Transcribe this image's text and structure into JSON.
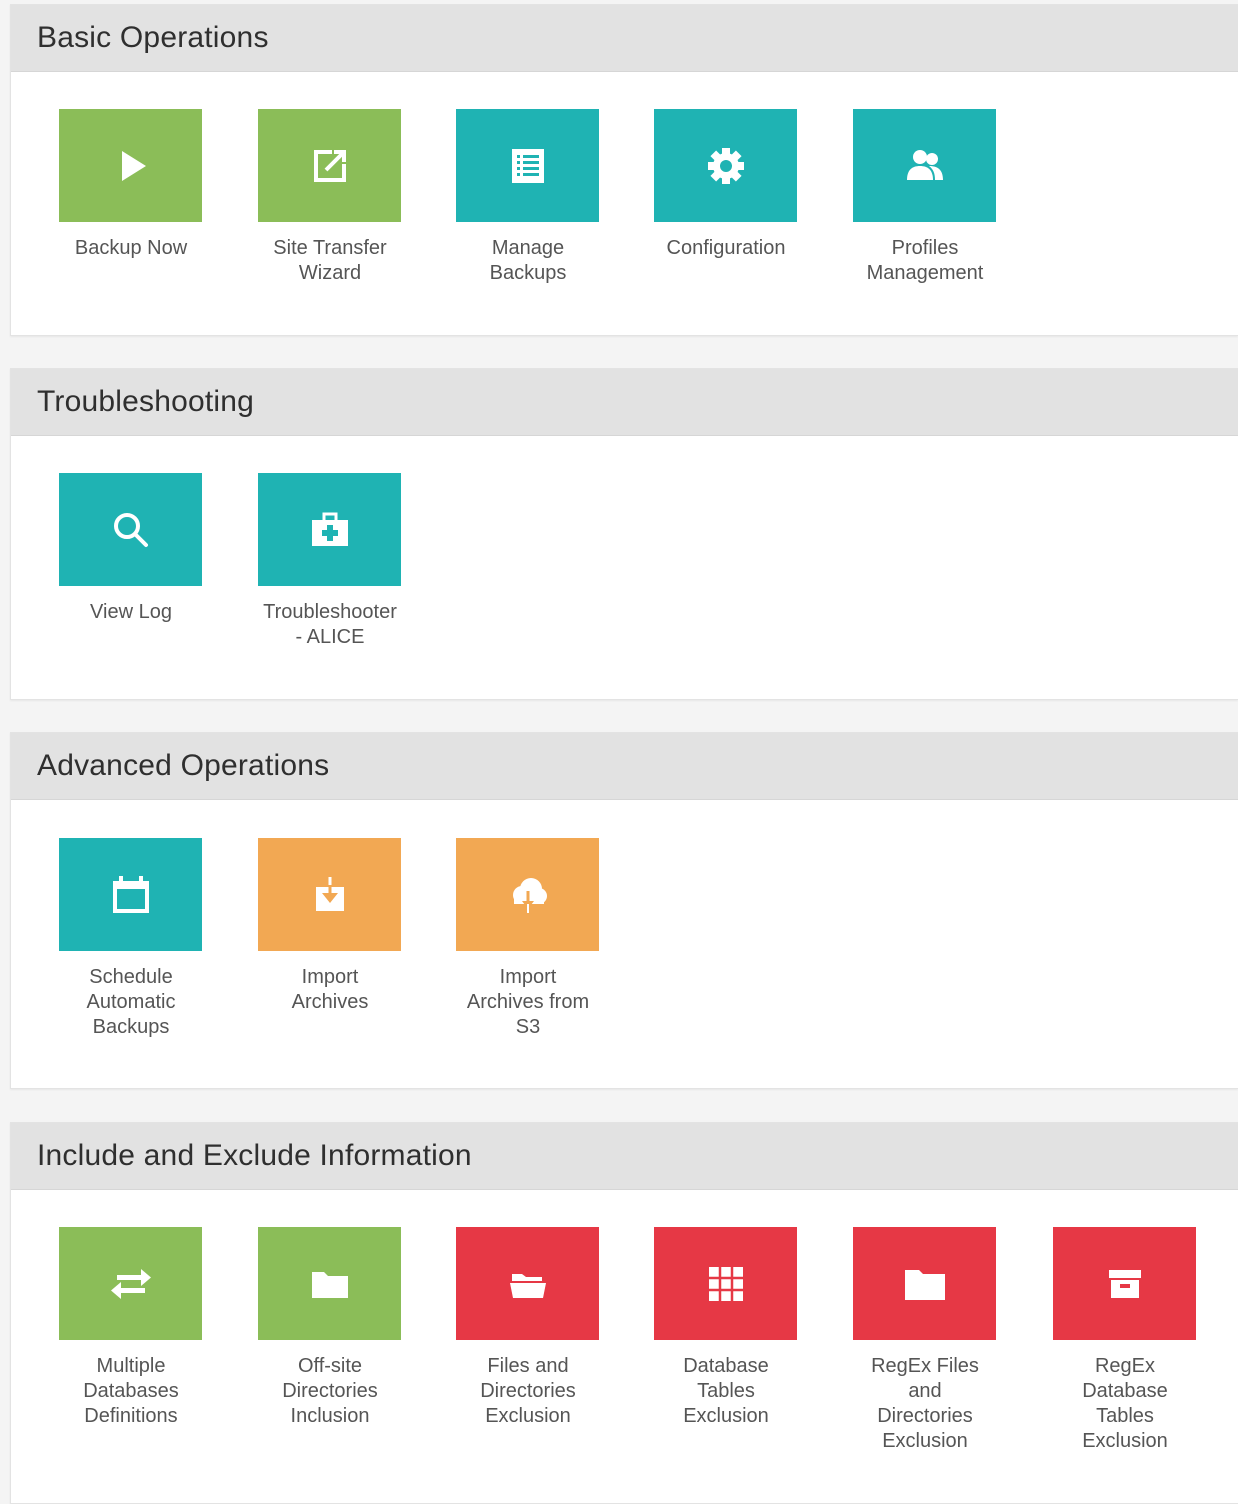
{
  "colors": {
    "green": "#8bbd58",
    "teal": "#1fb3b3",
    "orange": "#f2a853",
    "red": "#e63845",
    "header_bg": "#e2e2e2"
  },
  "sections": [
    {
      "title": "Basic Operations",
      "tiles": [
        {
          "label": "Backup Now",
          "color": "green",
          "icon": "play-icon"
        },
        {
          "label": "Site Transfer\nWizard",
          "color": "green",
          "icon": "external-link-icon"
        },
        {
          "label": "Manage\nBackups",
          "color": "teal",
          "icon": "list-icon"
        },
        {
          "label": "Configuration",
          "color": "teal",
          "icon": "gear-icon"
        },
        {
          "label": "Profiles\nManagement",
          "color": "teal",
          "icon": "users-icon"
        }
      ]
    },
    {
      "title": "Troubleshooting",
      "tiles": [
        {
          "label": "View Log",
          "color": "teal",
          "icon": "search-icon"
        },
        {
          "label": "Troubleshooter\n- ALICE",
          "color": "teal",
          "icon": "medkit-icon"
        }
      ]
    },
    {
      "title": "Advanced Operations",
      "tiles": [
        {
          "label": "Schedule\nAutomatic\nBackups",
          "color": "teal",
          "icon": "calendar-icon"
        },
        {
          "label": "Import\nArchives",
          "color": "orange",
          "icon": "import-icon"
        },
        {
          "label": "Import\nArchives from\nS3",
          "color": "orange",
          "icon": "cloud-download-icon"
        }
      ]
    },
    {
      "title": "Include and Exclude Information",
      "tiles": [
        {
          "label": "Multiple\nDatabases\nDefinitions",
          "color": "green",
          "icon": "transfer-arrows-icon"
        },
        {
          "label": "Off-site\nDirectories\nInclusion",
          "color": "green",
          "icon": "folder-icon"
        },
        {
          "label": "Files and\nDirectories\nExclusion",
          "color": "red",
          "icon": "folder-open-icon"
        },
        {
          "label": "Database\nTables\nExclusion",
          "color": "red",
          "icon": "table-grid-icon"
        },
        {
          "label": "RegEx Files\nand\nDirectories\nExclusion",
          "color": "red",
          "icon": "folder-icon"
        },
        {
          "label": "RegEx\nDatabase\nTables\nExclusion",
          "color": "red",
          "icon": "archive-box-icon"
        }
      ]
    }
  ]
}
